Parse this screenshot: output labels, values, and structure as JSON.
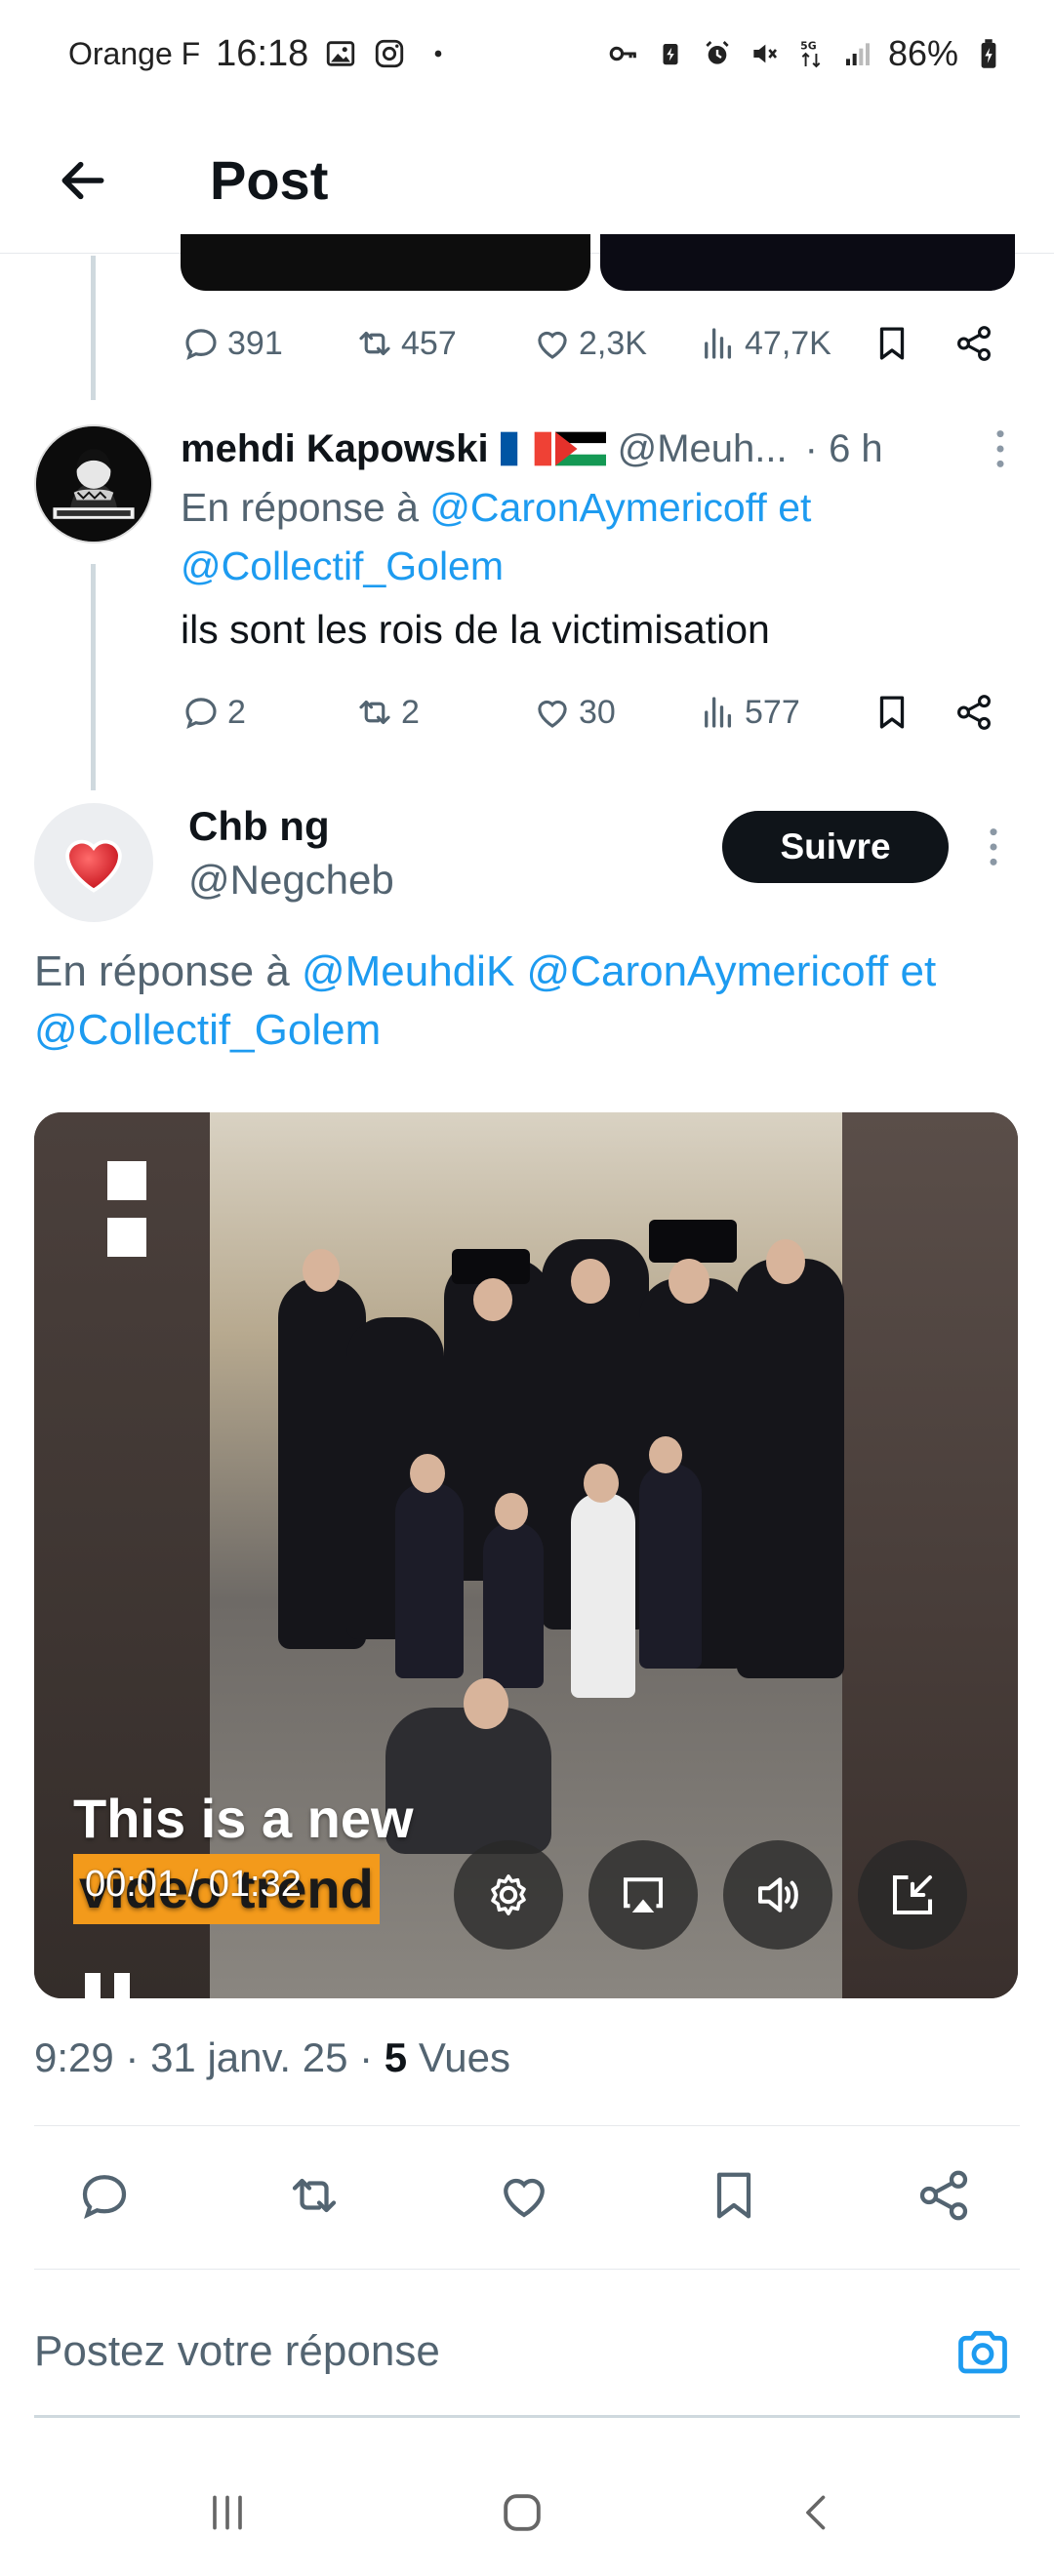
{
  "status_bar": {
    "carrier": "Orange F",
    "time": "16:18",
    "network": "5G",
    "battery": "86%"
  },
  "header": {
    "title": "Post",
    "back_icon": "arrow-left-icon"
  },
  "previous_tweet": {
    "stats": {
      "replies": "391",
      "reposts": "457",
      "likes": "2,3K",
      "views": "47,7K"
    }
  },
  "reply_tweet": {
    "name": "mehdi Kapowski",
    "handle": "@Meuh...",
    "time": "· 6 h",
    "reply_to_prefix": "En réponse à",
    "reply_to_mention_1": "@CaronAymericoff",
    "reply_to_and": "et",
    "reply_to_mention_2": "@Collectif_Golem",
    "text": "ils sont les rois de la victimisation",
    "stats": {
      "replies": "2",
      "reposts": "2",
      "likes": "30",
      "views": "577"
    }
  },
  "main_tweet": {
    "name": "Chb ng",
    "handle": "@Negcheb",
    "follow_label": "Suivre",
    "reply_to_prefix": "En réponse à",
    "reply_to_mention_1": "@MeuhdiK",
    "reply_to_mention_2": "@CaronAymericoff",
    "reply_to_and": "et",
    "reply_to_mention_3": "@Collectif_Golem",
    "video": {
      "caption_line1": "This is a new",
      "caption_line2": "video trend",
      "current_time": "00:01",
      "separator": "/",
      "duration": "01:32"
    },
    "meta_time": "9:29",
    "meta_date": "31 janv. 25",
    "meta_views_count": "5",
    "meta_views_label": "Vues"
  },
  "composer": {
    "placeholder": "Postez votre réponse"
  },
  "colors": {
    "accent": "#1d9bf0",
    "text": "#0f1419",
    "muted": "#536471",
    "follow_bg": "#0f1419"
  }
}
